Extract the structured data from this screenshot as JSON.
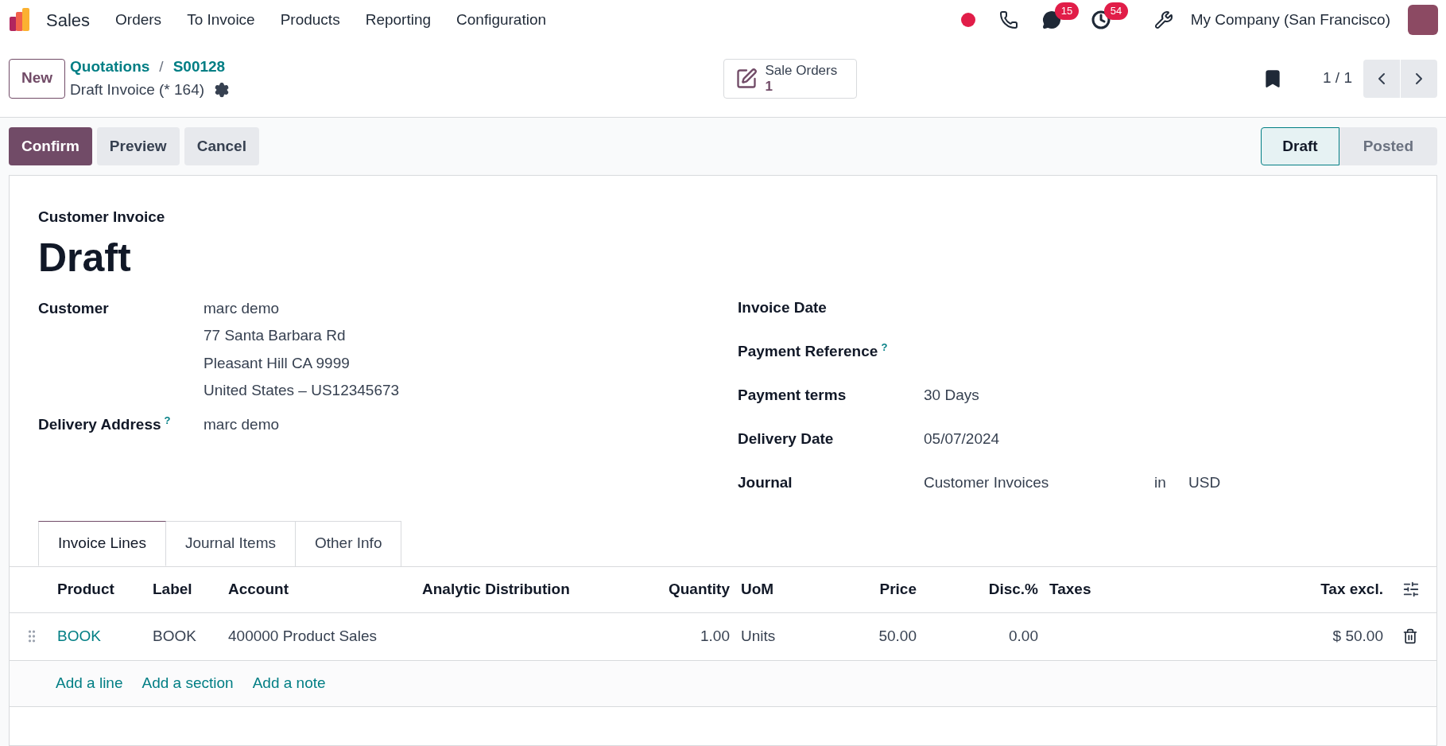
{
  "navbar": {
    "app_name": "Sales",
    "menu": [
      "Orders",
      "To Invoice",
      "Products",
      "Reporting",
      "Configuration"
    ],
    "messages_count": "15",
    "activities_count": "54",
    "company": "My Company (San Francisco)"
  },
  "control_panel": {
    "new_button": "New",
    "breadcrumbs": [
      "Quotations",
      "S00128"
    ],
    "breadcrumb_separator": "/",
    "record_name": "Draft Invoice (* 164)",
    "smart_button": {
      "label": "Sale Orders",
      "count": "1"
    },
    "pager": "1 / 1"
  },
  "actions": [
    {
      "label": "Confirm",
      "kind": "primary"
    },
    {
      "label": "Preview",
      "kind": "secondary"
    },
    {
      "label": "Cancel",
      "kind": "secondary"
    }
  ],
  "status_steps": [
    {
      "label": "Draft",
      "selected": true
    },
    {
      "label": "Posted",
      "selected": false
    }
  ],
  "form": {
    "type_label": "Customer Invoice",
    "title": "Draft",
    "left_fields": [
      {
        "label": "Customer",
        "lines": [
          "marc demo",
          "77 Santa Barbara Rd",
          "Pleasant Hill CA 9999",
          "United States – US12345673"
        ]
      },
      {
        "label": "Delivery Address",
        "help": "?",
        "lines": [
          "marc demo"
        ]
      }
    ],
    "right_fields": [
      {
        "label": "Invoice Date"
      },
      {
        "label": "Payment Reference",
        "help": "?"
      },
      {
        "label": "Payment terms",
        "values": [
          "30 Days"
        ]
      },
      {
        "label": "Delivery Date",
        "values": [
          "05/07/2024"
        ]
      },
      {
        "label": "Journal",
        "values": [
          "Customer Invoices",
          "in",
          "USD"
        ]
      }
    ]
  },
  "tabs": [
    {
      "label": "Invoice Lines",
      "selected": true
    },
    {
      "label": "Journal Items",
      "selected": false
    },
    {
      "label": "Other Info",
      "selected": false
    }
  ],
  "table": {
    "columns": [
      {
        "label": "Product",
        "kind": "text"
      },
      {
        "label": "Label",
        "kind": "text"
      },
      {
        "label": "Account",
        "kind": "text"
      },
      {
        "label": "Analytic Distribution",
        "kind": "text"
      },
      {
        "label": "Quantity",
        "kind": "number"
      },
      {
        "label": "UoM",
        "kind": "text"
      },
      {
        "label": "Price",
        "kind": "number"
      },
      {
        "label": "Disc.%",
        "kind": "number"
      },
      {
        "label": "Taxes",
        "kind": "text"
      },
      {
        "label": "Tax excl.",
        "kind": "number"
      }
    ],
    "rows": [
      {
        "cells": [
          "BOOK",
          "BOOK",
          "400000 Product Sales",
          "",
          "1.00",
          "Units",
          "50.00",
          "0.00",
          "",
          "$ 50.00"
        ]
      }
    ],
    "add_links": [
      "Add a line",
      "Add a section",
      "Add a note"
    ]
  }
}
